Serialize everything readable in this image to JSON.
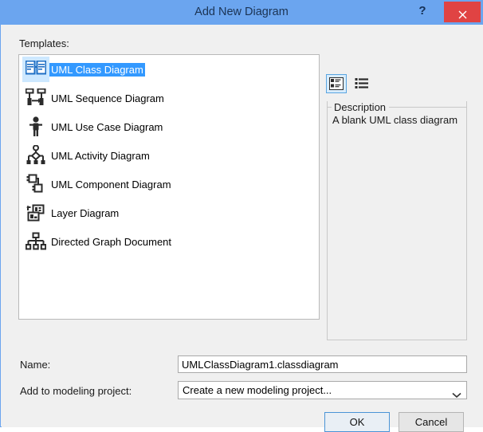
{
  "window": {
    "title": "Add New Diagram",
    "help_label": "?",
    "close_icon": "close-icon",
    "accent_color": "#6ba5ef",
    "close_color": "#e04343",
    "selection_color": "#3399ff"
  },
  "templates_section": {
    "label": "Templates:",
    "items": [
      {
        "label": "UML Class Diagram",
        "icon": "uml-class-diagram-icon",
        "selected": true
      },
      {
        "label": "UML Sequence Diagram",
        "icon": "uml-sequence-diagram-icon",
        "selected": false
      },
      {
        "label": "UML Use Case Diagram",
        "icon": "uml-use-case-diagram-icon",
        "selected": false
      },
      {
        "label": "UML Activity Diagram",
        "icon": "uml-activity-diagram-icon",
        "selected": false
      },
      {
        "label": "UML Component Diagram",
        "icon": "uml-component-diagram-icon",
        "selected": false
      },
      {
        "label": "Layer Diagram",
        "icon": "layer-diagram-icon",
        "selected": false
      },
      {
        "label": "Directed Graph Document",
        "icon": "directed-graph-document-icon",
        "selected": false
      }
    ]
  },
  "view_toggle": {
    "buttons": [
      {
        "name": "tiles-view-button",
        "icon": "tiles-view-icon",
        "active": true
      },
      {
        "name": "list-view-button",
        "icon": "list-view-icon",
        "active": false
      }
    ]
  },
  "description": {
    "legend": "Description",
    "text": "A blank UML class diagram"
  },
  "form": {
    "name_label": "Name:",
    "name_value": "UMLClassDiagram1.classdiagram",
    "name_placeholder": "",
    "project_label": "Add to modeling project:",
    "project_value": "Create a new modeling project...",
    "project_options": [
      "Create a new modeling project..."
    ]
  },
  "buttons": {
    "ok_label": "OK",
    "cancel_label": "Cancel"
  }
}
